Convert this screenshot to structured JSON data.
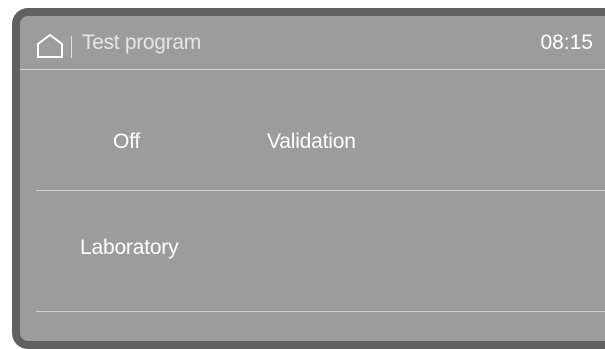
{
  "header": {
    "title": "Test program",
    "time": "08:15",
    "home_icon": "home-icon"
  },
  "options": {
    "off": "Off",
    "validation": "Validation",
    "laboratory": "Laboratory"
  },
  "colors": {
    "screen_bg": "#9c9c9c",
    "bezel": "#606060",
    "text": "#ffffff",
    "rule": "#d4d4d4"
  }
}
